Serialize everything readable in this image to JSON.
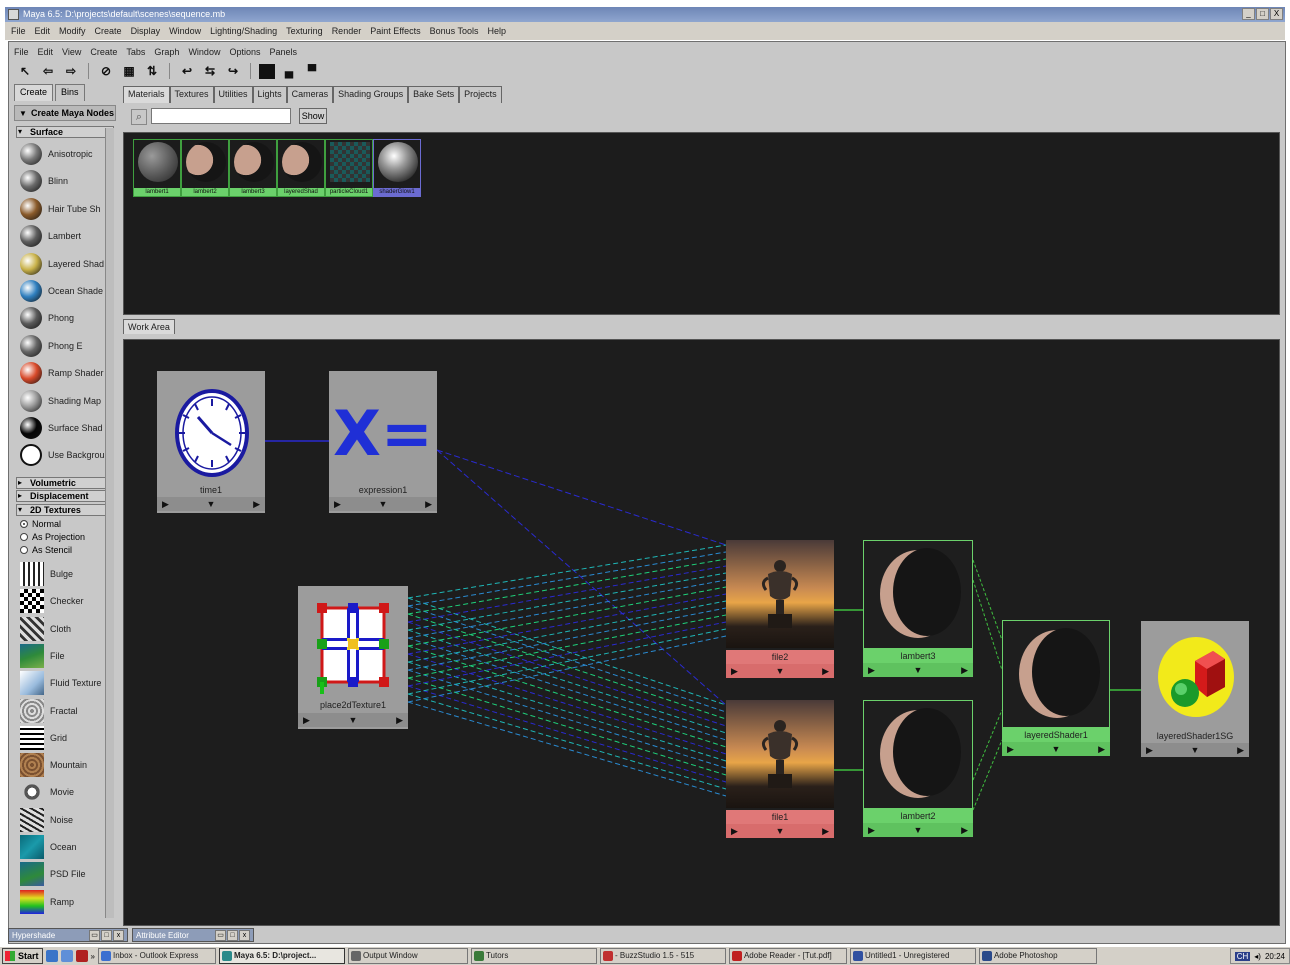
{
  "window": {
    "title": "Maya 6.5: D:\\projects\\default\\scenes\\sequence.mb",
    "controls": [
      "_",
      "□",
      "X"
    ]
  },
  "main_menu": [
    "File",
    "Edit",
    "Modify",
    "Create",
    "Display",
    "Window",
    "Lighting/Shading",
    "Texturing",
    "Render",
    "Paint Effects",
    "Bonus Tools",
    "Help"
  ],
  "hypershade": {
    "menu": [
      "File",
      "Edit",
      "View",
      "Create",
      "Tabs",
      "Graph",
      "Window",
      "Options",
      "Panels"
    ],
    "toolbar_icons": [
      "pointer-icon",
      "back-arrow-icon",
      "forward-arrow-icon",
      "graph-icon",
      "clear-graph-icon",
      "rearrange-icon",
      "input-connections-icon",
      "input-output-icon",
      "output-connections-icon",
      "top-panel-icon",
      "bottom-panel-icon",
      "both-panels-icon"
    ],
    "left_tabs": [
      "Create",
      "Bins"
    ],
    "create_menu": "Create Maya Nodes",
    "sections": {
      "surface": "Surface",
      "volumetric": "Volumetric",
      "displacement": "Displacement",
      "textures_2d": "2D Textures"
    },
    "surface_nodes": [
      {
        "label": "Anisotropic",
        "color": "#7a7a7a"
      },
      {
        "label": "Blinn",
        "color": "#6a6a6a"
      },
      {
        "label": "Hair Tube Sh",
        "color": "#8a5a2a"
      },
      {
        "label": "Lambert",
        "color": "#5e5e5e"
      },
      {
        "label": "Layered Shad",
        "color": "#c9b24a"
      },
      {
        "label": "Ocean Shade",
        "color": "#2f7fbf"
      },
      {
        "label": "Phong",
        "color": "#5a5a5a"
      },
      {
        "label": "Phong E",
        "color": "#666666"
      },
      {
        "label": "Ramp Shader",
        "color": "#d84a2a"
      },
      {
        "label": "Shading Map",
        "color": "#9a9a9a"
      },
      {
        "label": "Surface Shad",
        "color": "#050505"
      },
      {
        "label": "Use Background",
        "color": "#ffffff"
      }
    ],
    "texture_modes": [
      {
        "label": "Normal",
        "on": true
      },
      {
        "label": "As Projection",
        "on": false
      },
      {
        "label": "As Stencil",
        "on": false
      }
    ],
    "texture_nodes": [
      {
        "label": "Bulge",
        "icon": "bulge-icon"
      },
      {
        "label": "Checker",
        "icon": "checker-icon"
      },
      {
        "label": "Cloth",
        "icon": "cloth-icon"
      },
      {
        "label": "File",
        "icon": "file-icon"
      },
      {
        "label": "Fluid Texture",
        "icon": "fluid-texture-icon"
      },
      {
        "label": "Fractal",
        "icon": "fractal-icon"
      },
      {
        "label": "Grid",
        "icon": "grid-icon"
      },
      {
        "label": "Mountain",
        "icon": "mountain-icon"
      },
      {
        "label": "Movie",
        "icon": "movie-icon"
      },
      {
        "label": "Noise",
        "icon": "noise-icon"
      },
      {
        "label": "Ocean",
        "icon": "ocean-icon"
      },
      {
        "label": "PSD File",
        "icon": "psd-file-icon"
      },
      {
        "label": "Ramp",
        "icon": "ramp-icon"
      }
    ],
    "top_tabs": [
      "Materials",
      "Textures",
      "Utilities",
      "Lights",
      "Cameras",
      "Shading Groups",
      "Bake Sets",
      "Projects"
    ],
    "show_button": "Show",
    "materials": [
      {
        "label": "lambert1",
        "kind": "gray"
      },
      {
        "label": "lambert2",
        "kind": "moon"
      },
      {
        "label": "lambert3",
        "kind": "moon"
      },
      {
        "label": "layeredShad",
        "kind": "moon"
      },
      {
        "label": "particleCloud1",
        "kind": "cloud"
      },
      {
        "label": "shaderGlow1",
        "kind": "glow"
      }
    ],
    "work_tab": "Work Area",
    "nodes": {
      "time": "time1",
      "expression": "expression1",
      "place2d": "place2dTexture1",
      "file2": "file2",
      "file1": "file1",
      "lambert3": "lambert3",
      "lambert2": "lambert2",
      "layered_shader": "layeredShader1",
      "shading_group": "layeredShader1SG"
    },
    "expression_glyph": "X=",
    "node_bar": {
      "left": "▶",
      "mid": "▼",
      "right": "▶"
    }
  },
  "minimized_windows": [
    {
      "label": "Hypershade"
    },
    {
      "label": "Attribute Editor"
    }
  ],
  "taskbar": {
    "start": "Start",
    "buttons": [
      {
        "label": "Inbox - Outlook Express",
        "color": "#3b6fd0",
        "active": false
      },
      {
        "label": "Maya 6.5: D:\\project...",
        "color": "#2a8a8a",
        "active": true
      },
      {
        "label": "Output Window",
        "color": "#666666",
        "active": false
      },
      {
        "label": "Tutors",
        "color": "#3a7a3a",
        "active": false
      },
      {
        "label": "- BuzzStudio 1.5 - 515",
        "color": "#c03030",
        "active": false
      },
      {
        "label": "Adobe Reader - [Tut.pdf]",
        "color": "#c02020",
        "active": false
      },
      {
        "label": "Untitled1 - Unregistered",
        "color": "#3050a0",
        "active": false
      },
      {
        "label": "Adobe Photoshop",
        "color": "#2a4a8a",
        "active": false
      }
    ],
    "lang": "CH",
    "clock": "20:24"
  }
}
